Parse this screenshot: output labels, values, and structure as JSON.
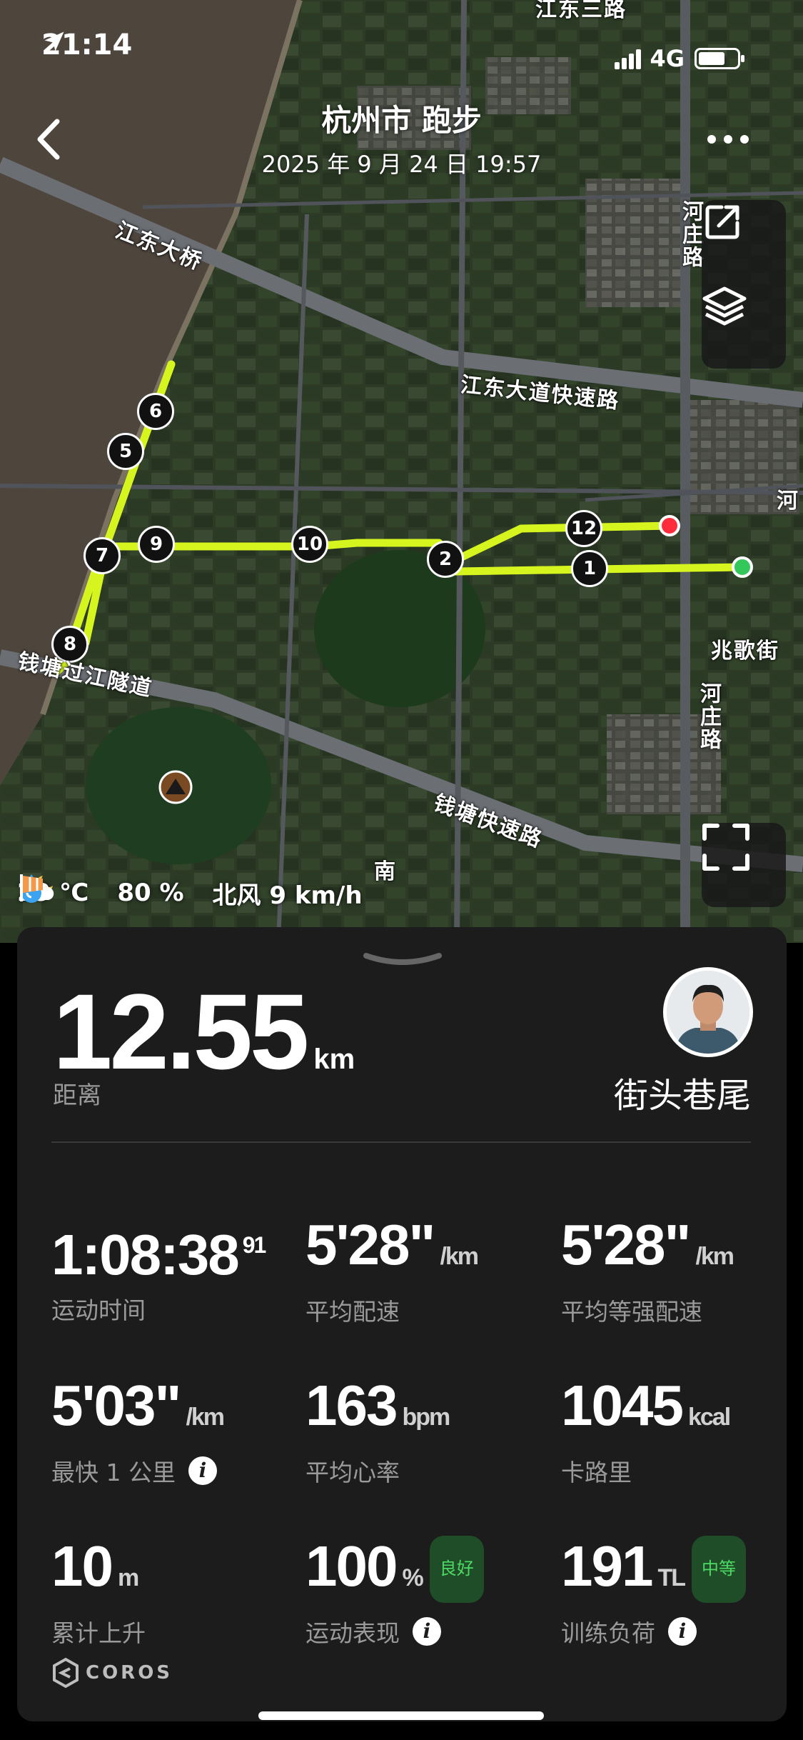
{
  "status_bar": {
    "time": "21:14",
    "network": "4G"
  },
  "header": {
    "title": "杭州市 跑步",
    "subtitle": "2025 年 9 月 24 日 19:57"
  },
  "map": {
    "road_labels": [
      "江东三路",
      "河庄路",
      "江东大桥",
      "江东大道快速路",
      "河",
      "兆歌街",
      "钱塘过江隧道",
      "河庄路",
      "钱塘快速路",
      "南"
    ],
    "km_markers": [
      "1",
      "2",
      "5",
      "6",
      "7",
      "8",
      "9",
      "10",
      "12"
    ]
  },
  "weather": {
    "temperature": "29 ℃",
    "humidity": "80 %",
    "wind": "北风 9 km/h"
  },
  "summary": {
    "distance_value": "12.55",
    "distance_unit": "km",
    "distance_label": "距离",
    "username": "街头巷尾"
  },
  "metrics": {
    "duration": {
      "value": "1:08:38",
      "sup": "91",
      "label": "运动时间"
    },
    "avg_pace": {
      "value": "5'28\"",
      "unit": "/km",
      "label": "平均配速"
    },
    "avg_effort_pace": {
      "value": "5'28\"",
      "unit": "/km",
      "label": "平均等强配速"
    },
    "fastest_km": {
      "value": "5'03\"",
      "unit": "/km",
      "label": "最快 1 公里"
    },
    "avg_hr": {
      "value": "163",
      "unit": "bpm",
      "label": "平均心率"
    },
    "calories": {
      "value": "1045",
      "unit": "kcal",
      "label": "卡路里"
    },
    "elevation_gain": {
      "value": "10",
      "unit": "m",
      "label": "累计上升"
    },
    "performance": {
      "value": "100",
      "unit": "%",
      "badge": "良好",
      "label": "运动表现"
    },
    "training_load": {
      "value": "191",
      "unit": "TL",
      "badge": "中等",
      "label": "训练负荷"
    }
  },
  "brand": {
    "logo_text": "COROS"
  },
  "colors": {
    "route": "#d6f51f",
    "start": "#34c759",
    "end": "#ff2d3b",
    "panel": "#1c1c1d",
    "badge_text": "#4cd964"
  }
}
